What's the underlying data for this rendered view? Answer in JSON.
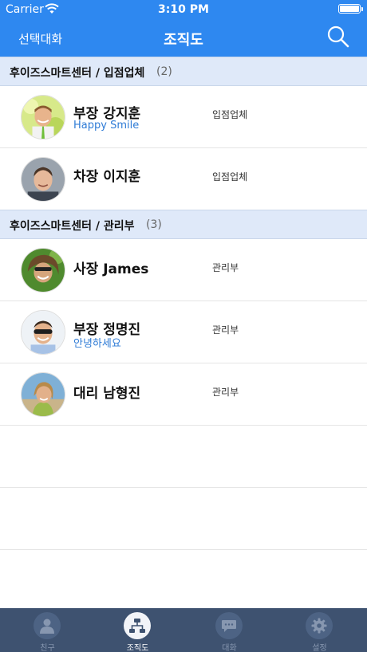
{
  "status_bar": {
    "carrier": "Carrier",
    "time": "3:10 PM"
  },
  "nav": {
    "left_label": "선택대화",
    "title": "조직도"
  },
  "sections": [
    {
      "title": "후이즈스마트센터 / 입점업체",
      "count": "(2)",
      "rows": [
        {
          "name": "부장 강지훈",
          "status": "Happy Smile",
          "dept": "입점업체"
        },
        {
          "name": "차장 이지훈",
          "status": "",
          "dept": "입점업체"
        }
      ]
    },
    {
      "title": "후이즈스마트센터 / 관리부",
      "count": "(3)",
      "rows": [
        {
          "name": "사장 James",
          "status": "",
          "dept": "관리부"
        },
        {
          "name": "부장 정명진",
          "status": "안녕하세요",
          "dept": "관리부"
        },
        {
          "name": "대리 남형진",
          "status": "",
          "dept": "관리부"
        }
      ]
    }
  ],
  "tabs": [
    {
      "label": "친구",
      "icon": "person-icon",
      "active": false
    },
    {
      "label": "조직도",
      "icon": "org-chart-icon",
      "active": true
    },
    {
      "label": "대화",
      "icon": "chat-icon",
      "active": false
    },
    {
      "label": "설정",
      "icon": "gear-icon",
      "active": false
    }
  ],
  "colors": {
    "header": "#2e88f0",
    "section_bg": "#dfe9f9",
    "status_text": "#2e7bd6",
    "tabbar": "#3e5270"
  }
}
